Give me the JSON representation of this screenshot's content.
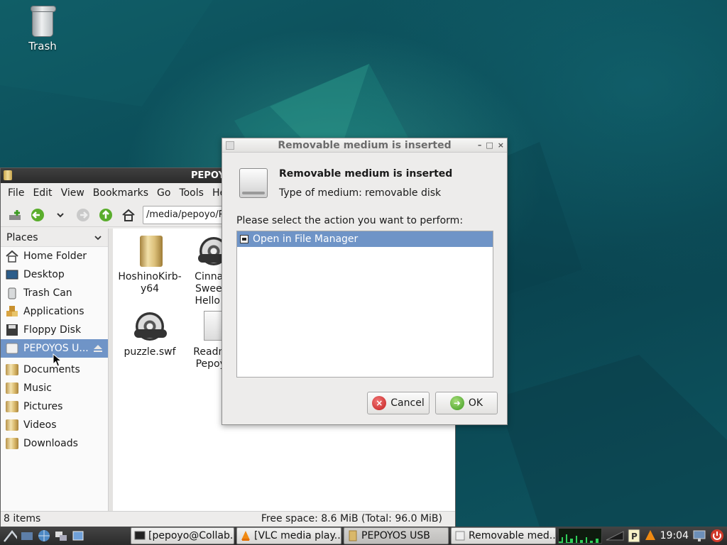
{
  "desktop": {
    "trash_label": "Trash"
  },
  "file_manager": {
    "title": "PEPOYO",
    "menu": [
      "File",
      "Edit",
      "View",
      "Bookmarks",
      "Go",
      "Tools",
      "He"
    ],
    "path": "/media/pepoyo/P",
    "places_header": "Places",
    "places": [
      {
        "label": "Home Folder",
        "icon": "home-icon"
      },
      {
        "label": "Desktop",
        "icon": "desktop-icon"
      },
      {
        "label": "Trash Can",
        "icon": "trash-icon"
      },
      {
        "label": "Applications",
        "icon": "applications-icon"
      },
      {
        "label": "Floppy Disk",
        "icon": "floppy-icon"
      },
      {
        "label": "PEPOYOS U...",
        "icon": "usb-drive-icon",
        "selected": true
      }
    ],
    "bookmarks": [
      {
        "label": "Documents"
      },
      {
        "label": "Music"
      },
      {
        "label": "Pictures"
      },
      {
        "label": "Videos"
      },
      {
        "label": "Downloads"
      }
    ],
    "files": [
      {
        "line1": "HoshinoKirb-",
        "line2": "y64",
        "line3": "",
        "icon": "folder-icon"
      },
      {
        "line1": "Cinnam",
        "line2": "Sweetn",
        "line3": "Hello Ki",
        "icon": "film-reel-icon"
      },
      {
        "line1": "puzzle.swf",
        "line2": "",
        "line3": "",
        "icon": "film-reel-icon"
      },
      {
        "line1": "Readme",
        "line2": "Pepoyo",
        "line3": "",
        "icon": "document-icon"
      }
    ],
    "status_items": "8 items",
    "status_free": "Free space: 8.6 MiB (Total: 96.0 MiB)"
  },
  "dialog": {
    "title": "Removable medium is inserted",
    "heading": "Removable medium is inserted",
    "type_label": "Type of medium:",
    "type_value": "removable disk",
    "prompt": "Please select the action you want to perform:",
    "actions": [
      "Open in File Manager"
    ],
    "cancel_label": "Cancel",
    "ok_label": "OK"
  },
  "taskbar": {
    "tasks": [
      {
        "label": "[pepoyo@Collab...",
        "icon": "terminal-icon"
      },
      {
        "label": "[VLC media play...",
        "icon": "vlc-icon"
      },
      {
        "label": "PEPOYOS USB",
        "icon": "folder-icon",
        "active": true
      },
      {
        "label": "Removable med...",
        "icon": "drive-icon"
      }
    ],
    "clock": "19:04"
  },
  "colors": {
    "selection": "#6f94c7",
    "desktop": "#0d4f57",
    "titlebar_dark": "#2b2b2b"
  }
}
